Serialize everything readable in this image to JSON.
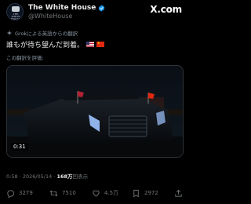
{
  "header": {
    "display_name": "The White House",
    "handle": "@WhiteHouse",
    "verified": true,
    "avatar_text": "THE WHITE HOUSE",
    "platform_logo": "X.com"
  },
  "translation": {
    "note": "Grokによる英語からの翻訳",
    "icon": "sparkle-icon"
  },
  "tweet": {
    "text": "誰もが待ち望んだ到着。",
    "flags": [
      "US",
      "CN"
    ],
    "rate_translation": "この翻訳を評価:"
  },
  "media": {
    "type": "video",
    "duration": "0:31"
  },
  "meta": {
    "time": "0:58",
    "separator": " · ",
    "date": "2026/05/14",
    "views": "168万",
    "views_suffix": "回表示"
  },
  "actions": {
    "replies": "3279",
    "retweets": "7510",
    "likes": "4.5万",
    "bookmarks": "2972"
  },
  "colors": {
    "background": "#000000",
    "text": "#e7e9ea",
    "secondary": "#71767b",
    "verified": "#1d9bf0"
  }
}
